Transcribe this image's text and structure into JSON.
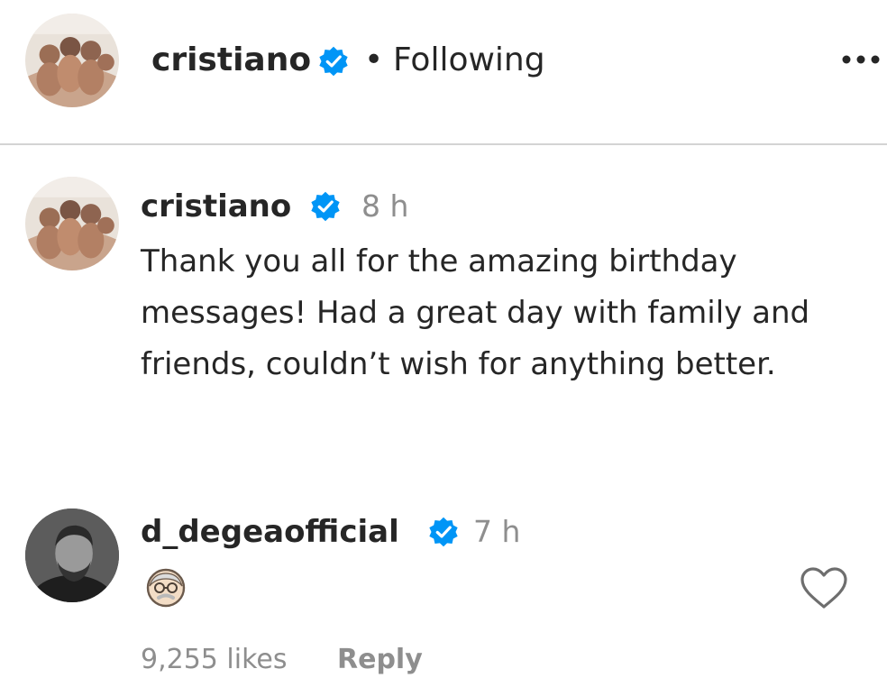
{
  "header": {
    "username": "cristiano",
    "separator": "•",
    "follow_status": "Following",
    "avatar_icon": "family-photo-avatar",
    "verified_icon": "verified-badge-icon",
    "more_icon": "more-options-icon"
  },
  "comments": [
    {
      "username": "cristiano",
      "time": "8 h",
      "text": "Thank you all for the amazing birthday messages! Had a great day with family and friends, couldn’t wish for anything better.",
      "avatar_icon": "family-photo-avatar",
      "verified_icon": "verified-badge-icon"
    },
    {
      "username": "d_degeaofficial",
      "time": "7 h",
      "emoji_icon": "older-man-emoji-icon",
      "avatar_icon": "portrait-photo-avatar",
      "verified_icon": "verified-badge-icon",
      "likes": "9,255 likes",
      "reply_label": "Reply",
      "like_icon": "heart-outline-icon"
    }
  ],
  "colors": {
    "verified_blue": "#0095f6",
    "text_primary": "#262626",
    "text_secondary": "#8e8e8e",
    "divider": "#d4d4d4"
  }
}
